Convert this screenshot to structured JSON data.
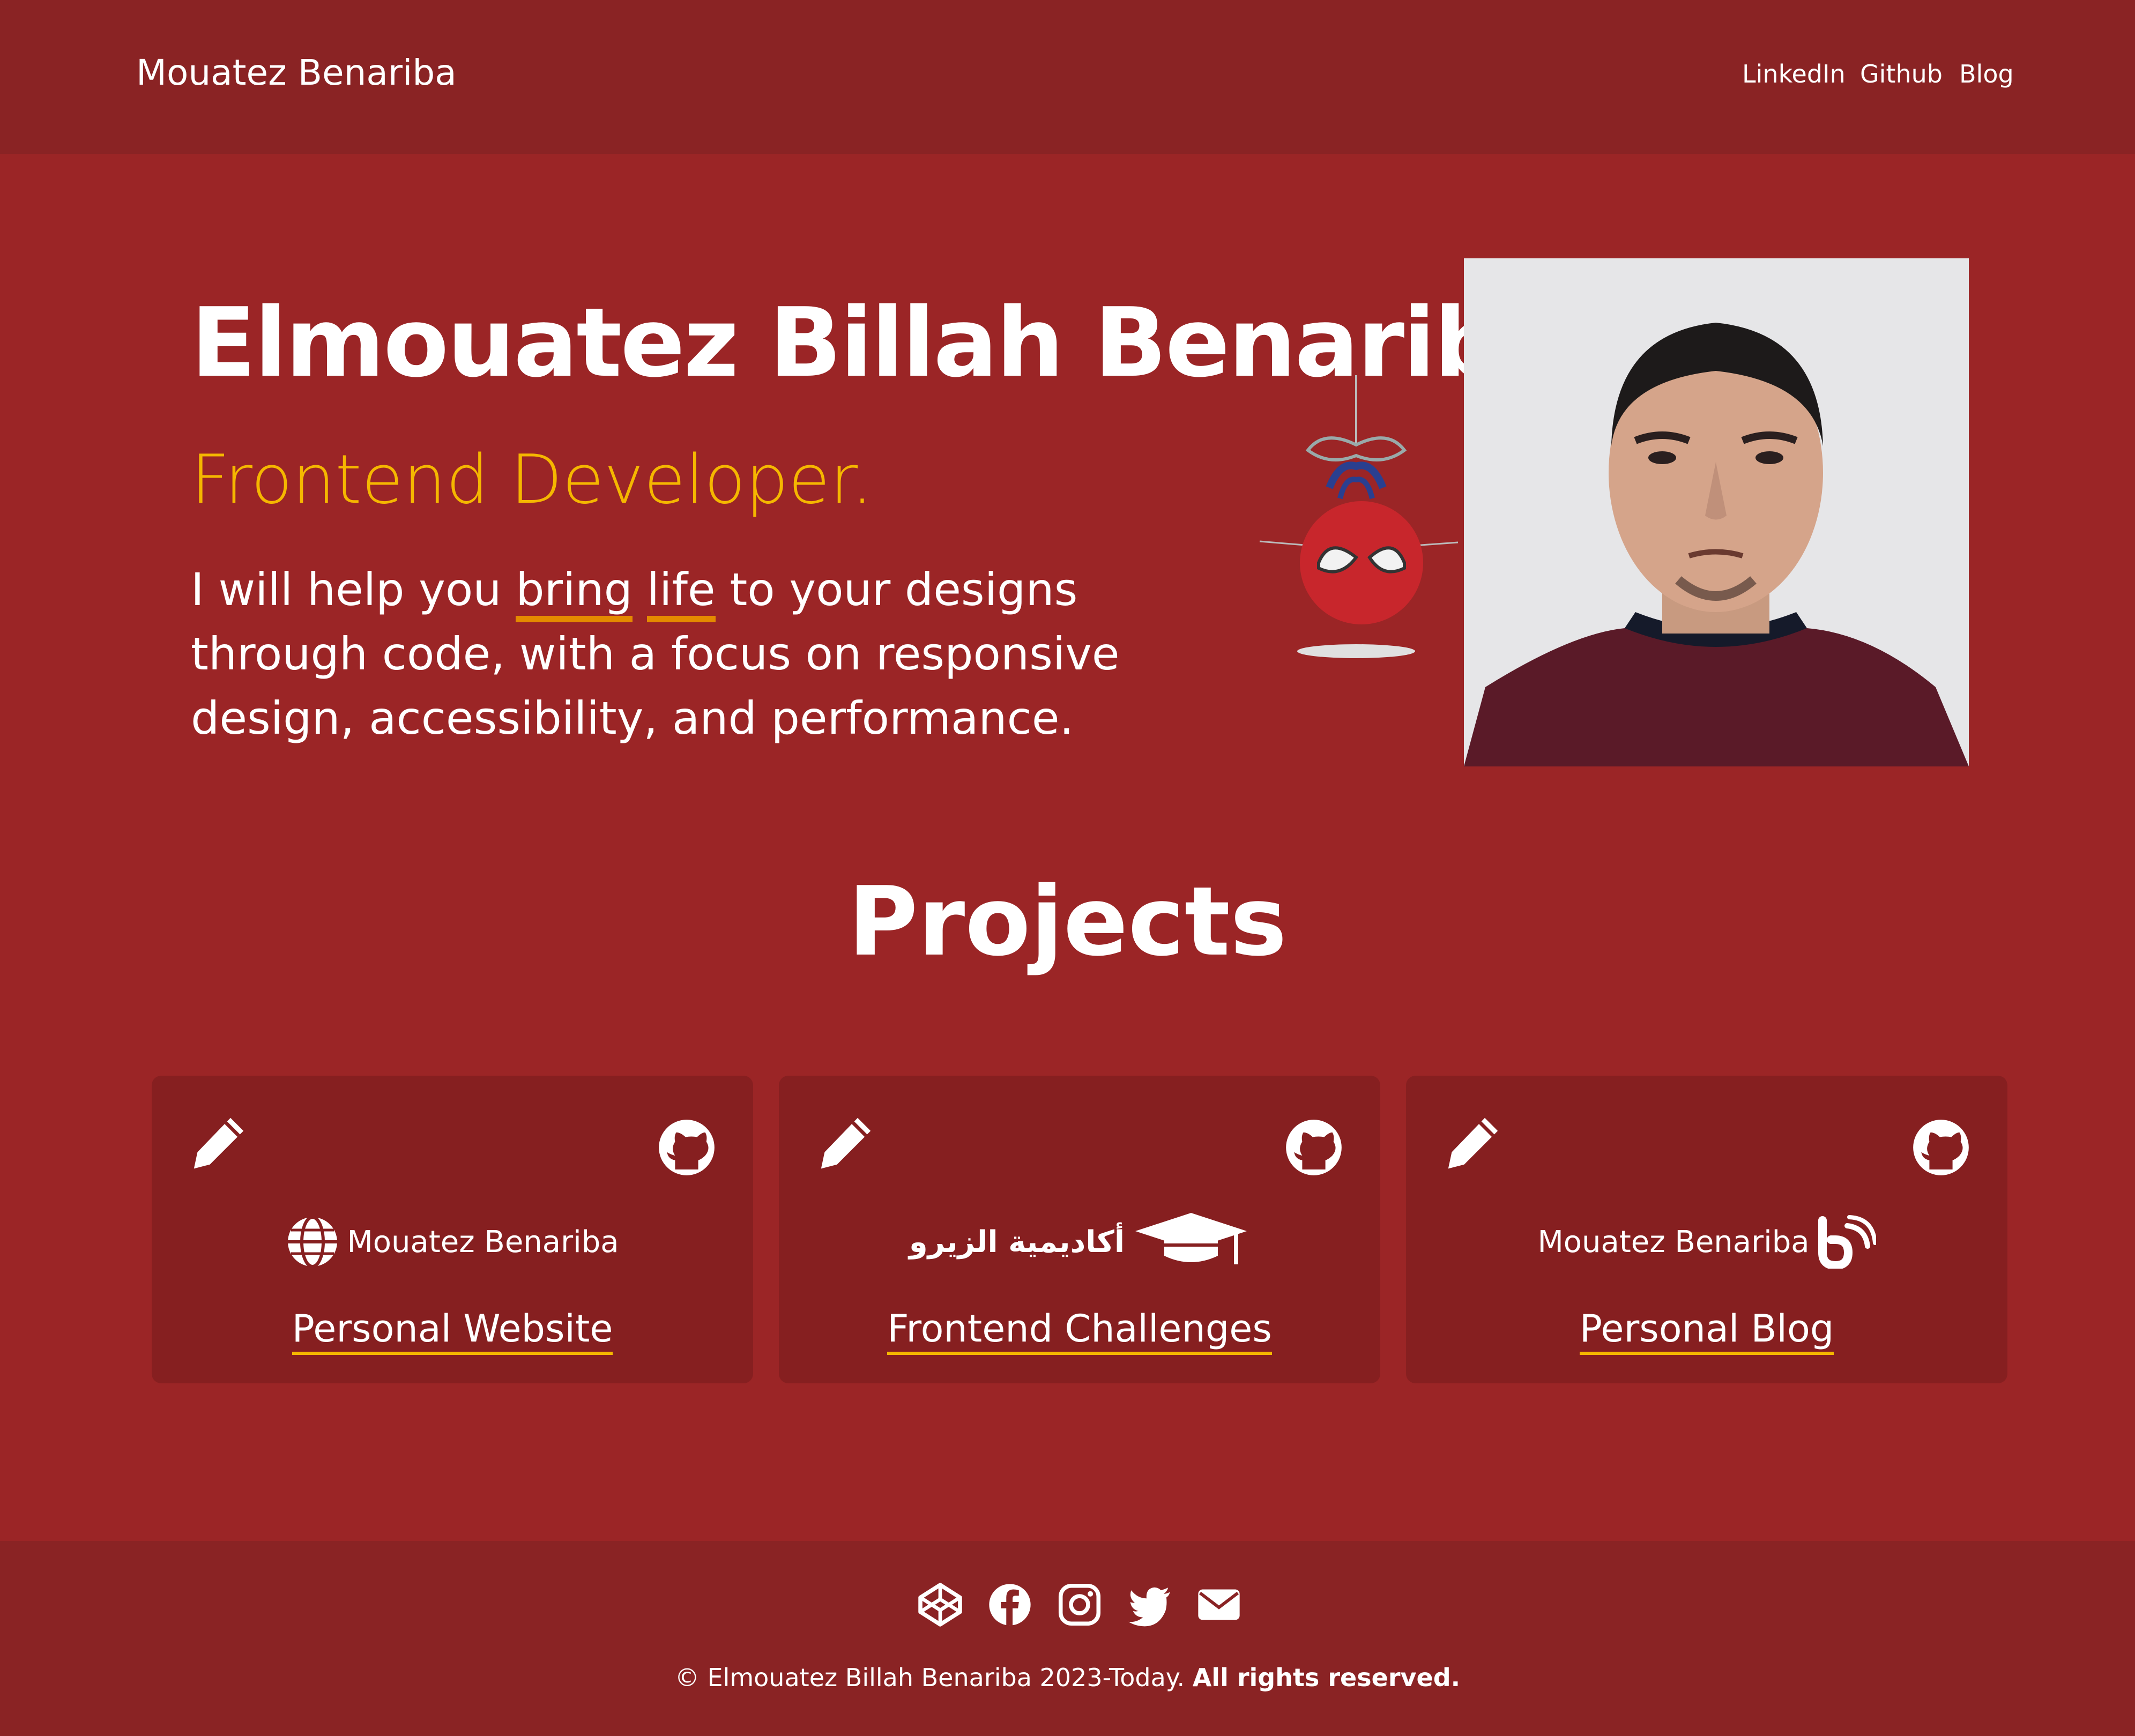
{
  "header": {
    "brand": "Mouatez Benariba",
    "nav": [
      "LinkedIn",
      "Github",
      "Blog"
    ]
  },
  "hero": {
    "title": "Elmouatez Billah Benariba",
    "subtitle": "Frontend Developer.",
    "desc_before": "I will help you ",
    "desc_hl1": "bring",
    "desc_space": " ",
    "desc_hl2": "life",
    "desc_after": " to your designs through code, with a focus on responsive design, accessibility, and performance."
  },
  "projects": {
    "title": "Projects",
    "items": [
      {
        "logo_text": "Mouatez Benariba",
        "link": "Personal Website"
      },
      {
        "logo_text": "أكاديمية الزيرو",
        "link": "Frontend Challenges"
      },
      {
        "logo_text": "Mouatez Benariba",
        "link": "Personal Blog"
      }
    ]
  },
  "footer": {
    "copyright": "© Elmouatez Billah Benariba 2023-Today.",
    "rights": "All rights reserved.",
    "social_icons": [
      "codepen-icon",
      "facebook-icon",
      "instagram-icon",
      "twitter-icon",
      "email-icon"
    ]
  },
  "colors": {
    "background": "#9b2526",
    "header_footer": "#8a2324",
    "card": "#861f20",
    "accent_yellow": "#f5b700",
    "highlight_orange": "#e48a00"
  }
}
